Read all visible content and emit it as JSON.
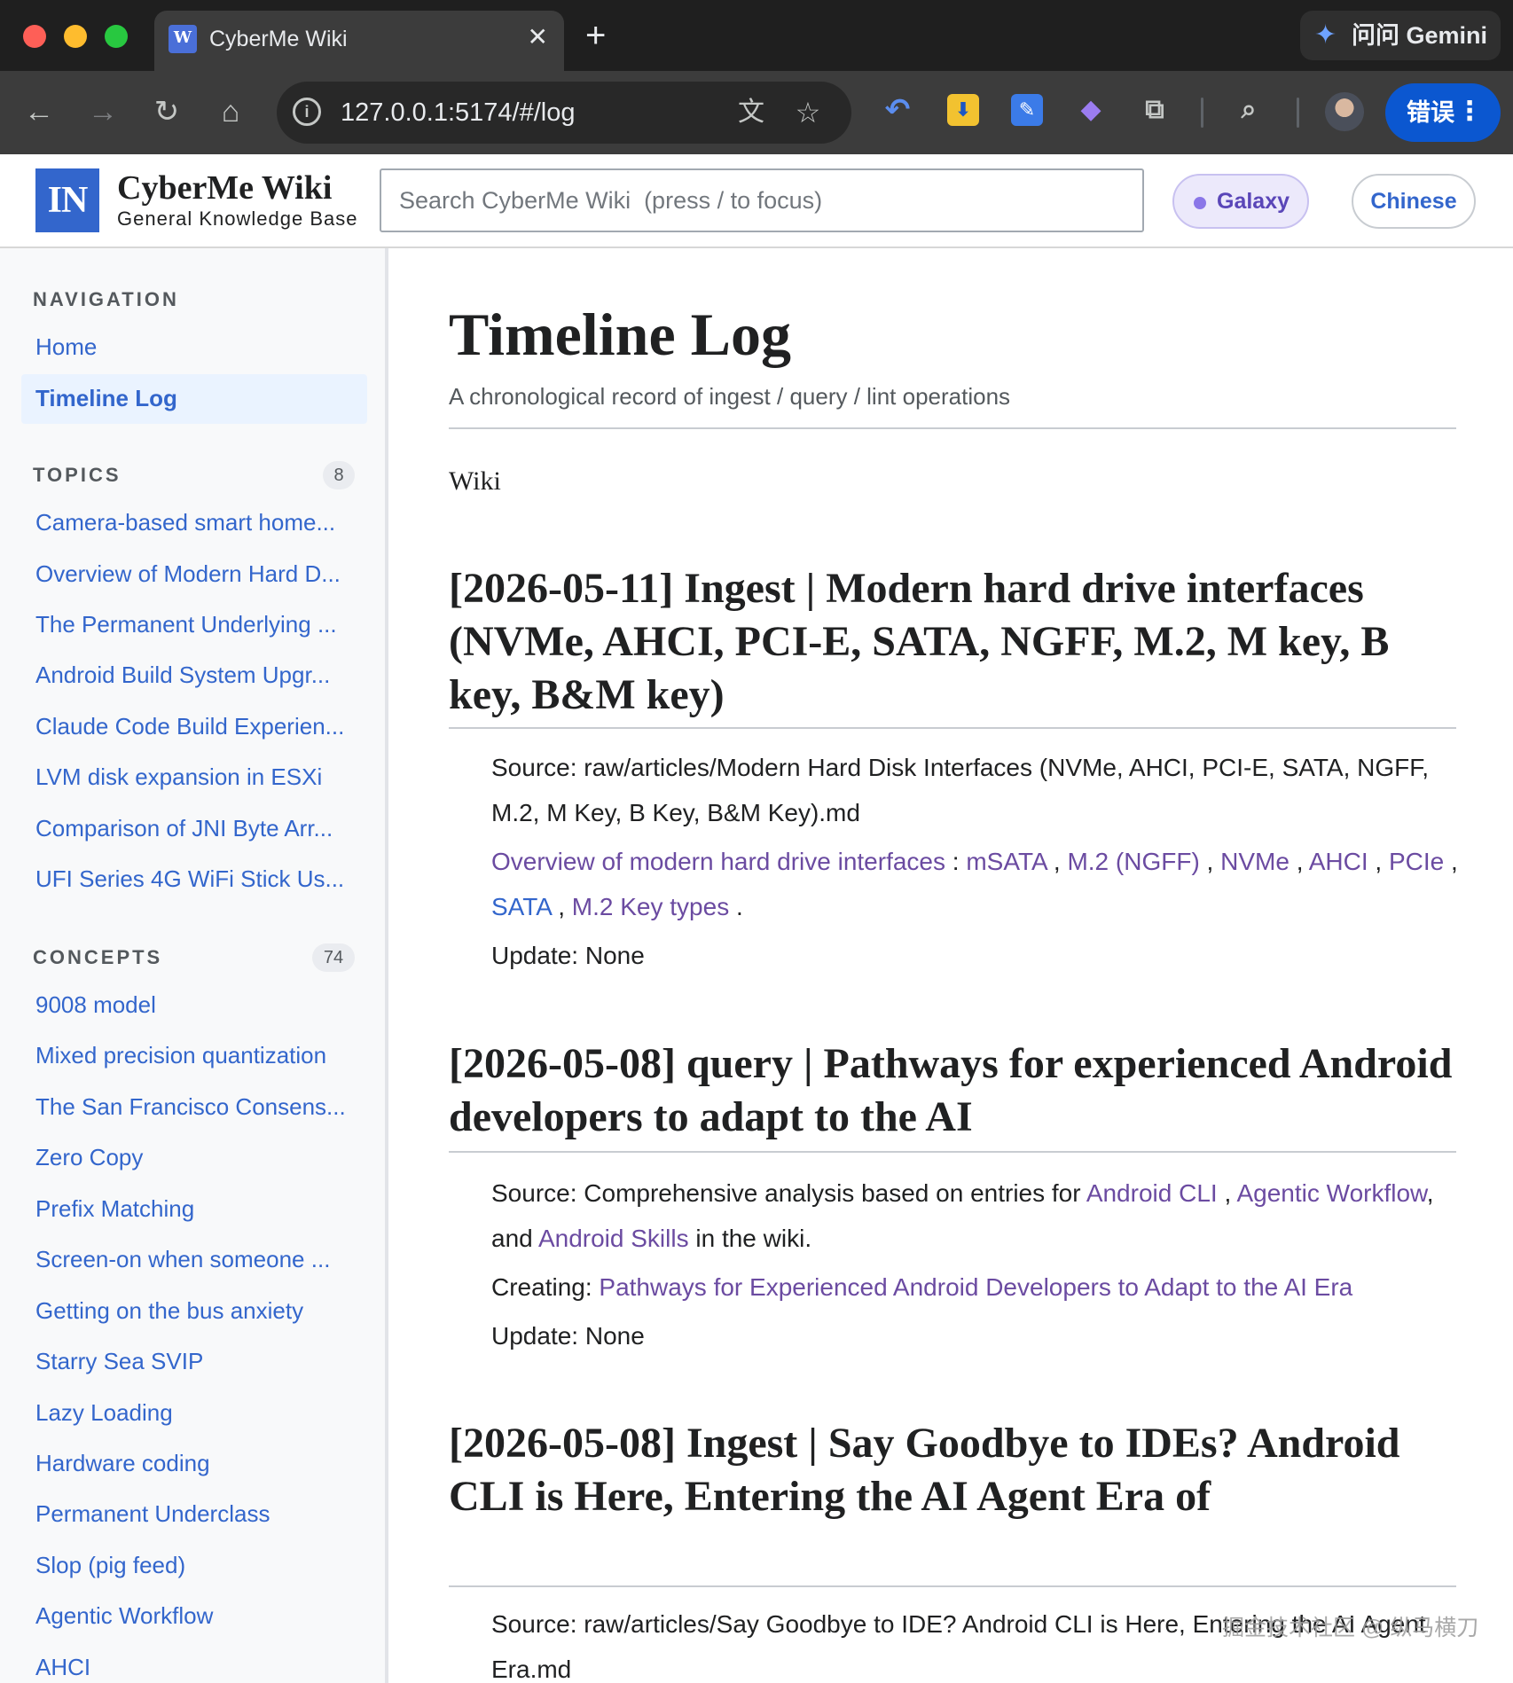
{
  "browser": {
    "tab_title": "CyberMe Wiki",
    "tab_favicon_letter": "W",
    "tab_close": "✕",
    "new_tab": "+",
    "gemini_label": "问问 Gemini",
    "url": "127.0.0.1:5174/#/log",
    "error_button": "错误",
    "icons": [
      "back-icon",
      "forward-icon",
      "reload-icon",
      "home-icon",
      "info-icon",
      "translate-icon",
      "bookmark-star-icon",
      "undo-icon",
      "download-icon",
      "ext-icon",
      "perplexity-icon",
      "puzzle-icon",
      "tab-search-icon",
      "more-icon"
    ]
  },
  "header": {
    "logo_text": "IN",
    "title": "CyberMe Wiki",
    "subtitle": "General Knowledge Base",
    "search_placeholder": "Search CyberMe Wiki  (press / to focus)",
    "galaxy_label": "Galaxy",
    "language_label": "Chinese",
    "colors": {
      "brand": "#3366cc",
      "galaxy_bg": "#ece9fb",
      "galaxy_text": "#5a46b8"
    }
  },
  "sidebar": {
    "navigation": {
      "heading": "NAVIGATION",
      "items": [
        "Home",
        "Timeline Log"
      ],
      "active": "Timeline Log"
    },
    "topics": {
      "heading": "TOPICS",
      "count": "8",
      "items": [
        "Camera-based smart home...",
        "Overview of Modern Hard D...",
        "The Permanent Underlying ...",
        "Android Build System Upgr...",
        "Claude Code Build Experien...",
        "LVM disk expansion in ESXi",
        "Comparison of JNI Byte Arr...",
        "UFI Series 4G WiFi Stick Us..."
      ]
    },
    "concepts": {
      "heading": "CONCEPTS",
      "count": "74",
      "items": [
        "9008 model",
        "Mixed precision quantization",
        "The San Francisco Consens...",
        "Zero Copy",
        "Prefix Matching",
        "Screen-on when someone ...",
        "Getting on the bus anxiety",
        "Starry Sea SVIP",
        "Lazy Loading",
        "Hardware coding",
        "Permanent Underclass",
        "Slop (pig feed)",
        "Agentic Workflow",
        "AHCI"
      ]
    }
  },
  "main": {
    "title": "Timeline Log",
    "subtitle": "A chronological record of ingest / query / lint operations",
    "section_label": "Wiki",
    "entries": [
      {
        "title": "[2026-05-11] Ingest | Modern hard drive interfaces (NVMe, AHCI, PCI-E, SATA, NGFF, M.2, M key, B key, B&M key)",
        "source_label": "Source:",
        "source_text": "raw/articles/Modern Hard Disk Interfaces (NVMe, AHCI, PCI-E, SATA, NGFF, M.2, M Key, B Key, B&M Key).md",
        "links_lead": "Overview of modern hard drive interfaces",
        "links_colon": ":",
        "links": [
          "mSATA",
          "M.2 (NGFF)",
          "NVMe",
          "AHCI",
          "PCIe",
          "SATA",
          "M.2 Key types"
        ],
        "sep": ",",
        "end": ".",
        "update": "Update: None"
      },
      {
        "title": "[2026-05-08] query | Pathways for experienced Android developers to adapt to the AI",
        "source_prefix": "Source: Comprehensive analysis based on entries for",
        "link_a": "Android CLI",
        "comma": ",",
        "link_b": "Agentic Workflow",
        "and_text": ", and",
        "link_c": "Android Skills",
        "source_suffix": "in the wiki.",
        "creating_label": "Creating:",
        "creating_link": "Pathways for Experienced Android Developers to Adapt to the AI Era",
        "update": "Update: None"
      },
      {
        "title": "[2026-05-08] Ingest | Say Goodbye to IDEs? Android CLI is Here, Entering the AI Agent Era of",
        "source_text": "Source: raw/articles/Say Goodbye to IDE? Android CLI is Here, Entering the AI Agent Era.md"
      }
    ]
  },
  "watermark": "掘金技术社区 @ 纵马横刀"
}
